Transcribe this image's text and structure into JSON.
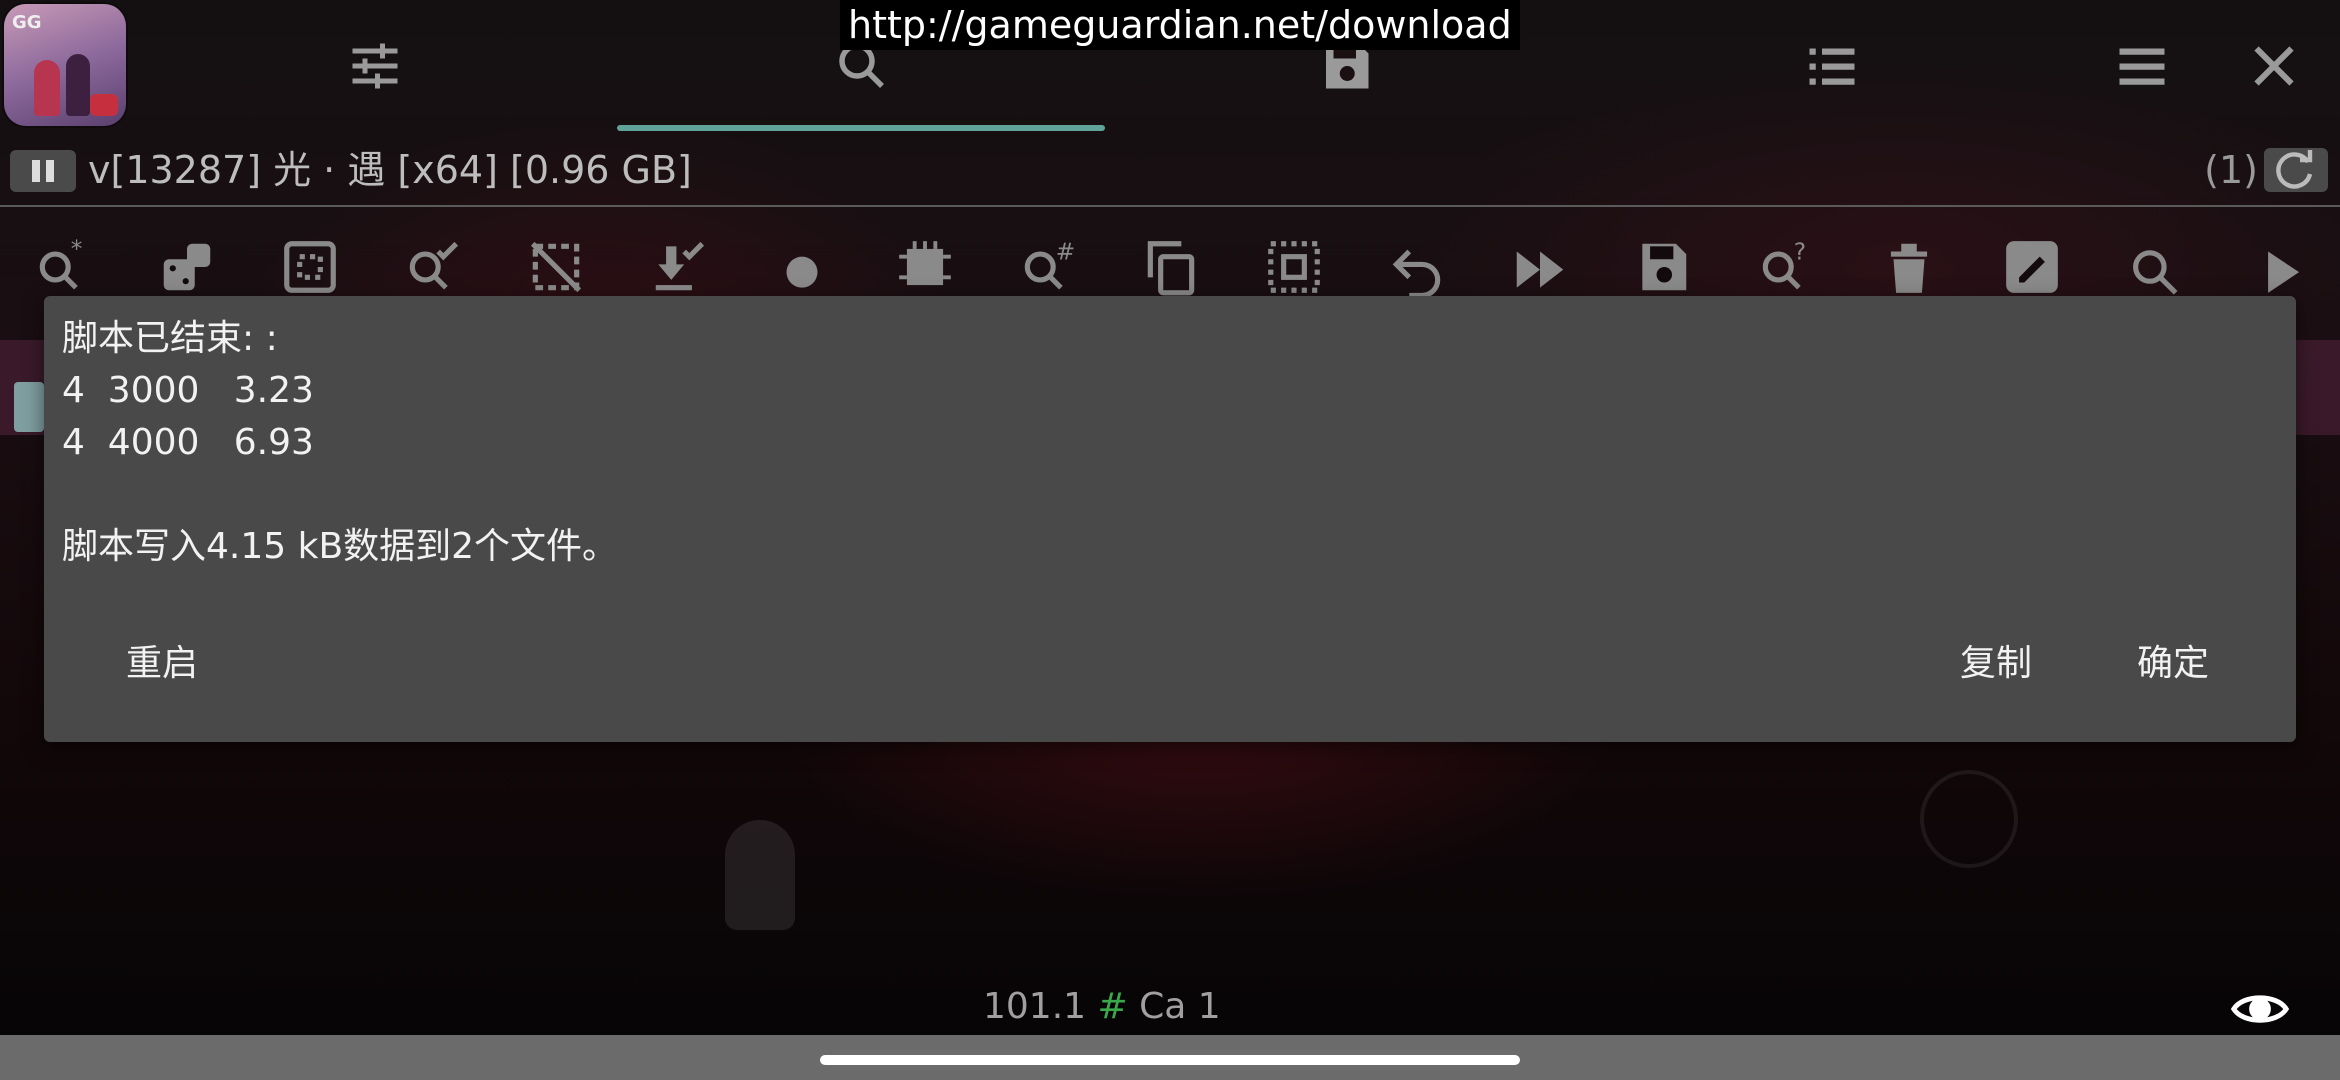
{
  "banner": {
    "url": "http://gameguardian.net/download"
  },
  "app": {
    "name": "GameGuardian"
  },
  "process": {
    "label": "v[13287] 光 · 遇 [x64] [0.96 GB]",
    "count": "(1)"
  },
  "top_toolbar": {
    "icons": [
      "settings-sliders-icon",
      "search-icon",
      "save-icon",
      "list-icon",
      "menu-icon",
      "close-icon"
    ],
    "active_tab": "search"
  },
  "tools": [
    "search-fuzzy-icon",
    "dice-icon",
    "select-area-icon",
    "search-check-icon",
    "deselect-icon",
    "import-check-icon",
    "record-icon",
    "chip-icon",
    "search-number-icon",
    "copy-icon",
    "select-all-icon",
    "undo-icon",
    "fast-forward-icon",
    "save-icon",
    "search-unknown-icon",
    "delete-icon",
    "edit-icon",
    "search-icon",
    "play-icon"
  ],
  "dialog": {
    "title": "脚本已结束: :",
    "lines": [
      "4  3000   3.23",
      "4  4000   6.93"
    ],
    "summary": "脚本写入4.15 kB数据到2个文件。",
    "restart_label": "重启",
    "copy_label": "复制",
    "ok_label": "确定"
  },
  "bottom": {
    "stat_value": "101.1",
    "stat_hash": "#",
    "stat_suffix": "Ca 1"
  },
  "colors": {
    "accent": "#5fa39b",
    "dialog_bg": "#494949",
    "hash": "#3aa84a"
  }
}
